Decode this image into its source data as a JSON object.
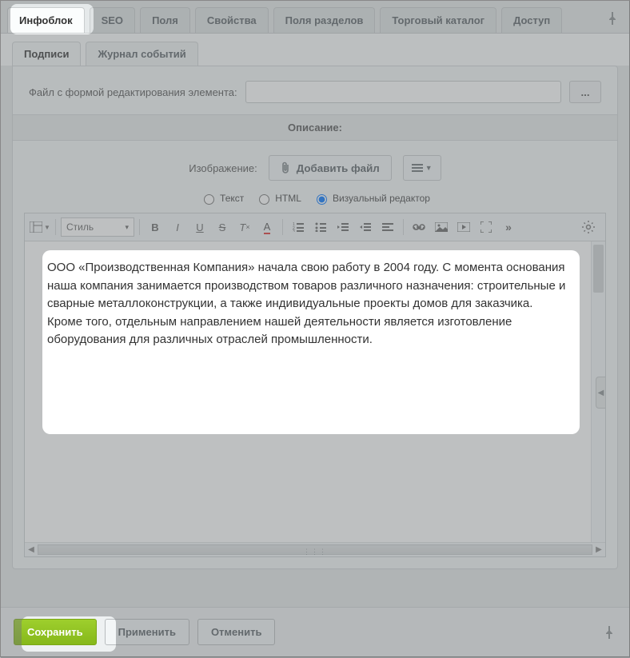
{
  "tabs_top": [
    {
      "label": "Инфоблок",
      "active": true
    },
    {
      "label": "SEO"
    },
    {
      "label": "Поля"
    },
    {
      "label": "Свойства"
    },
    {
      "label": "Поля разделов"
    },
    {
      "label": "Торговый каталог"
    },
    {
      "label": "Доступ"
    }
  ],
  "tabs_sub": [
    {
      "label": "Подписи",
      "active": true
    },
    {
      "label": "Журнал событий"
    }
  ],
  "form": {
    "edit_file_label": "Файл с формой редактирования элемента:",
    "edit_file_value": "",
    "browse_label": "...",
    "section_description": "Описание:",
    "image_label": "Изображение:",
    "add_file_label": "Добавить файл"
  },
  "editor_modes": {
    "text": "Текст",
    "html": "HTML",
    "visual": "Визуальный редактор",
    "selected": "visual"
  },
  "toolbar": {
    "style_placeholder": "Стиль"
  },
  "content": "ООО «Производственная Компания» начала свою работу в 2004 году. С момента основания наша компания занимается производством товаров различного назначения: строительные и сварные металлоконструкции, а также индивидуальные проекты домов для заказчика. Кроме того, отдельным направлением нашей деятельности является изготовление оборудования для различных отраслей промышленности.",
  "footer": {
    "save": "Сохранить",
    "apply": "Применить",
    "cancel": "Отменить"
  }
}
